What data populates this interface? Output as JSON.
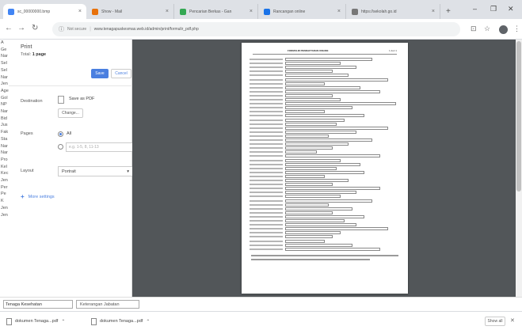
{
  "tabs": [
    {
      "title": "sc_00000000.bmp",
      "color": "#4285f4",
      "active": true
    },
    {
      "title": "Show - Mail",
      "color": "#e8710a",
      "active": false
    },
    {
      "title": "Pencarian Berkas - Gan",
      "color": "#34a853",
      "active": false
    },
    {
      "title": "Rancangan online",
      "color": "#1a73e8",
      "active": false
    },
    {
      "title": "https://sekolah.go.id",
      "color": "#777777",
      "active": false
    }
  ],
  "toolbar": {
    "back_icon": "arrow-left-icon",
    "forward_icon": "arrow-right-icon",
    "reload_icon": "reload-icon",
    "not_secure": "Not secure",
    "url": "www.tenagapuskesmas.web.id/admin/print/formulir_pdf.php"
  },
  "page_left_labels": [
    "A",
    "Ge",
    "Nar",
    "Sel",
    "Sel",
    "Nar",
    "Jen",
    "Age",
    "Gol",
    "NP",
    "Nar",
    "Bid",
    "Jus",
    "Fak",
    "Sta",
    "Nar",
    "Nar",
    "Pro",
    "Kel",
    "Kec",
    "Jen",
    "Per",
    "Pe",
    "K",
    "Jen",
    "Jen"
  ],
  "print": {
    "title": "Print",
    "total_label": "Total: ",
    "total_value": "1 page",
    "save_label": "Save",
    "cancel_label": "Cancel",
    "destination_label": "Destination",
    "destination_value": "Save as PDF",
    "change_label": "Change...",
    "pages_label": "Pages",
    "pages_all": "All",
    "pages_placeholder": "e.g. 1-5, 8, 11-13",
    "layout_label": "Layout",
    "layout_value": "Portrait",
    "more_settings": "More settings"
  },
  "sheet": {
    "title": "FORMULIR PENDAFTARAN ONLINE",
    "page": "1 dari 1"
  },
  "bottom_fields": {
    "field1": "Tenaga Kesehatan",
    "field2": "Keterangan Jabatan"
  },
  "downloads": [
    {
      "name": "dokumen Tenaga...pdf"
    },
    {
      "name": "dokumen Tenaga...pdf"
    }
  ],
  "show_all": "Show all"
}
